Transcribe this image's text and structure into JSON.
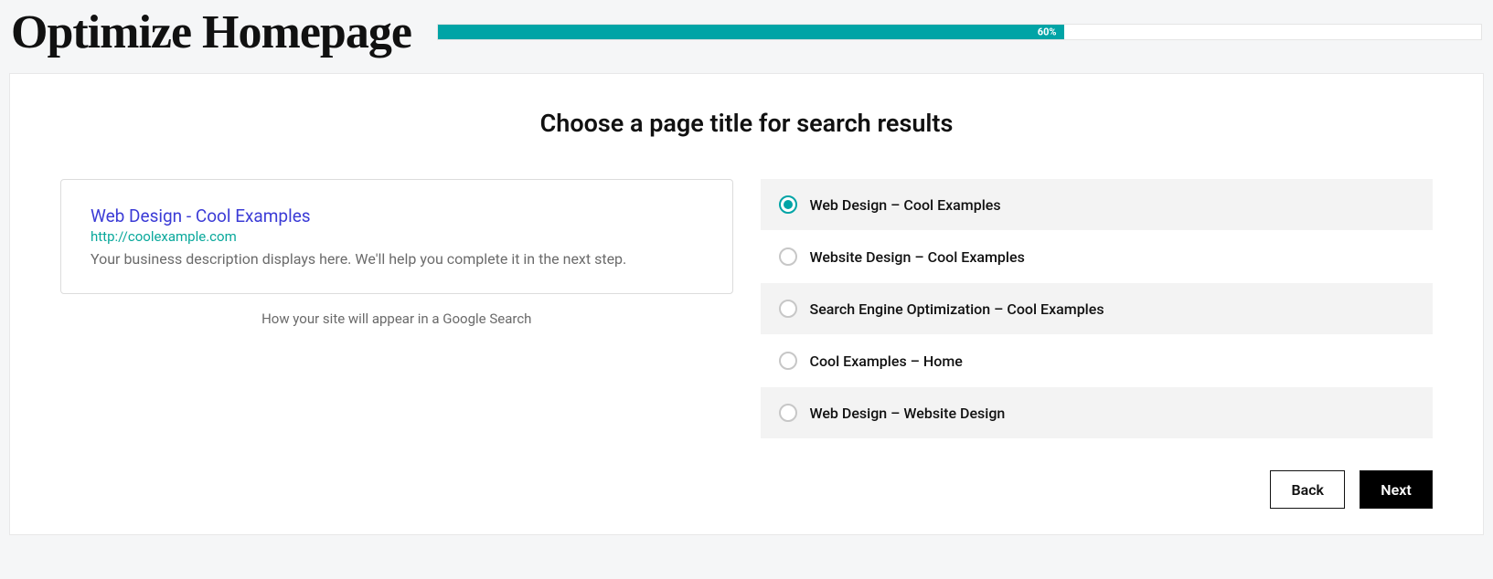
{
  "header": {
    "title": "Optimize Homepage",
    "progress_percent": 60,
    "progress_label": "60%"
  },
  "main": {
    "heading": "Choose a page title for search results",
    "preview": {
      "title": "Web Design - Cool Examples",
      "url": "http://coolexample.com",
      "description": "Your business description displays here. We'll help you complete it in the next step.",
      "caption": "How your site will appear in a Google Search"
    },
    "options": [
      {
        "label": "Web Design – Cool Examples",
        "selected": true
      },
      {
        "label": "Website Design – Cool Examples",
        "selected": false
      },
      {
        "label": "Search Engine Optimization – Cool Examples",
        "selected": false
      },
      {
        "label": "Cool Examples – Home",
        "selected": false
      },
      {
        "label": "Web Design – Website Design",
        "selected": false
      }
    ]
  },
  "buttons": {
    "back": "Back",
    "next": "Next"
  },
  "colors": {
    "accent": "#00a4a6"
  }
}
